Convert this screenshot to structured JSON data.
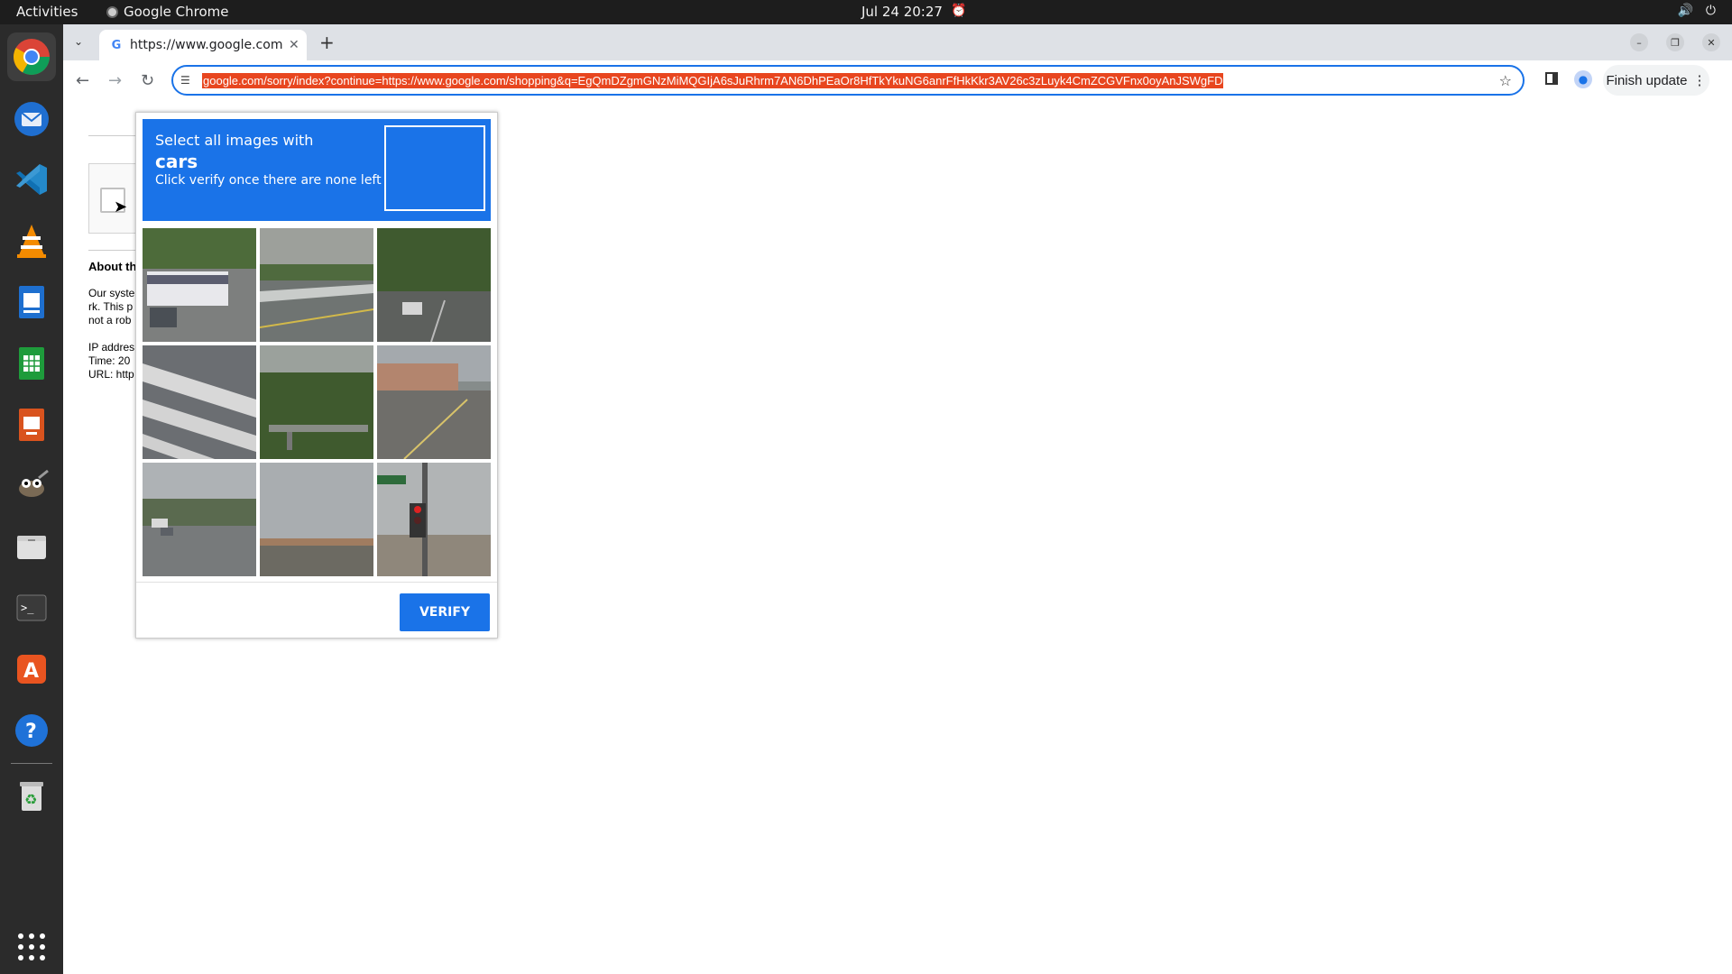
{
  "topbar": {
    "activities": "Activities",
    "app_name": "Google Chrome",
    "clock": "Jul 24  20:27"
  },
  "dock": {
    "items": [
      "chrome-icon",
      "thunderbird-icon",
      "vscode-icon",
      "vlc-icon",
      "writer-icon",
      "calc-icon",
      "impress-icon",
      "gimp-icon",
      "files-icon",
      "terminal-icon",
      "app-center-icon",
      "help-icon",
      "trash-icon",
      "app-grid-icon"
    ]
  },
  "browser": {
    "tab_title": "https://www.google.com",
    "url": "google.com/sorry/index?continue=https://www.google.com/shopping&q=EgQmDZgmGNzMiMQGIjA6sJuRhrm7AN6DhPEaOr8HfTkYkuNG6anrFfHkKkr3AV26c3zLuyk4CmZCGVFnx0oyAnJSWgFD",
    "finish_update": "Finish update"
  },
  "page": {
    "about_heading": "About th",
    "para1": [
      "Our syste",
      "rk. This p",
      "not a rob"
    ],
    "para2": [
      "IP addres",
      "Time: 20",
      "URL: http"
    ]
  },
  "captcha": {
    "instruction_line1": "Select all images with",
    "target": "cars",
    "instruction_line3": "Click verify once there are none left",
    "verify_label": "VERIFY",
    "tiles": [
      {
        "desc": "bus-and-car-road"
      },
      {
        "desc": "highway-barrier"
      },
      {
        "desc": "tree-lined-street-car"
      },
      {
        "desc": "crosswalk-stripes"
      },
      {
        "desc": "bridge-trees"
      },
      {
        "desc": "storefront-road"
      },
      {
        "desc": "street-with-cars"
      },
      {
        "desc": "sky-and-road"
      },
      {
        "desc": "traffic-light-sign"
      }
    ]
  },
  "colors": {
    "captcha_blue": "#1a73e8",
    "url_highlight": "#e8461f",
    "topbar_bg": "#1d1d1d",
    "dock_bg": "#2b2b2b"
  }
}
